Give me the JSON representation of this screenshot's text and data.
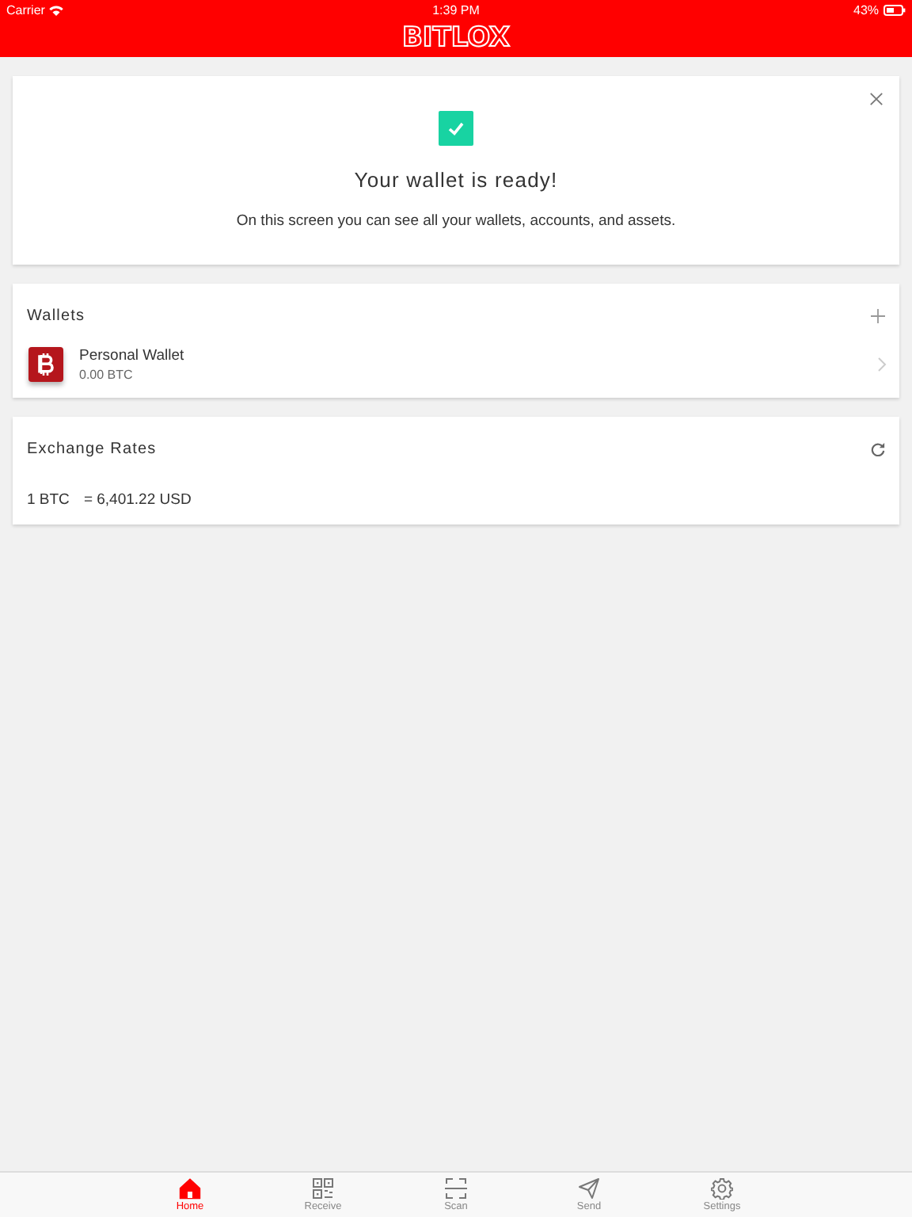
{
  "status_bar": {
    "carrier": "Carrier",
    "time": "1:39 PM",
    "battery": "43%"
  },
  "header": {
    "logo": "BITLOX"
  },
  "ready_card": {
    "title": "Your wallet is ready!",
    "message": "On this screen you can see all your wallets, accounts, and assets."
  },
  "wallets": {
    "title": "Wallets",
    "items": [
      {
        "name": "Personal Wallet",
        "balance": "0.00 BTC"
      }
    ]
  },
  "exchange_rates": {
    "title": "Exchange Rates",
    "rows": [
      {
        "unit": "1 BTC",
        "value": "= 6,401.22 USD"
      }
    ]
  },
  "tabs": [
    {
      "label": "Home",
      "selected": true
    },
    {
      "label": "Receive",
      "selected": false
    },
    {
      "label": "Scan",
      "selected": false
    },
    {
      "label": "Send",
      "selected": false
    },
    {
      "label": "Settings",
      "selected": false
    }
  ]
}
